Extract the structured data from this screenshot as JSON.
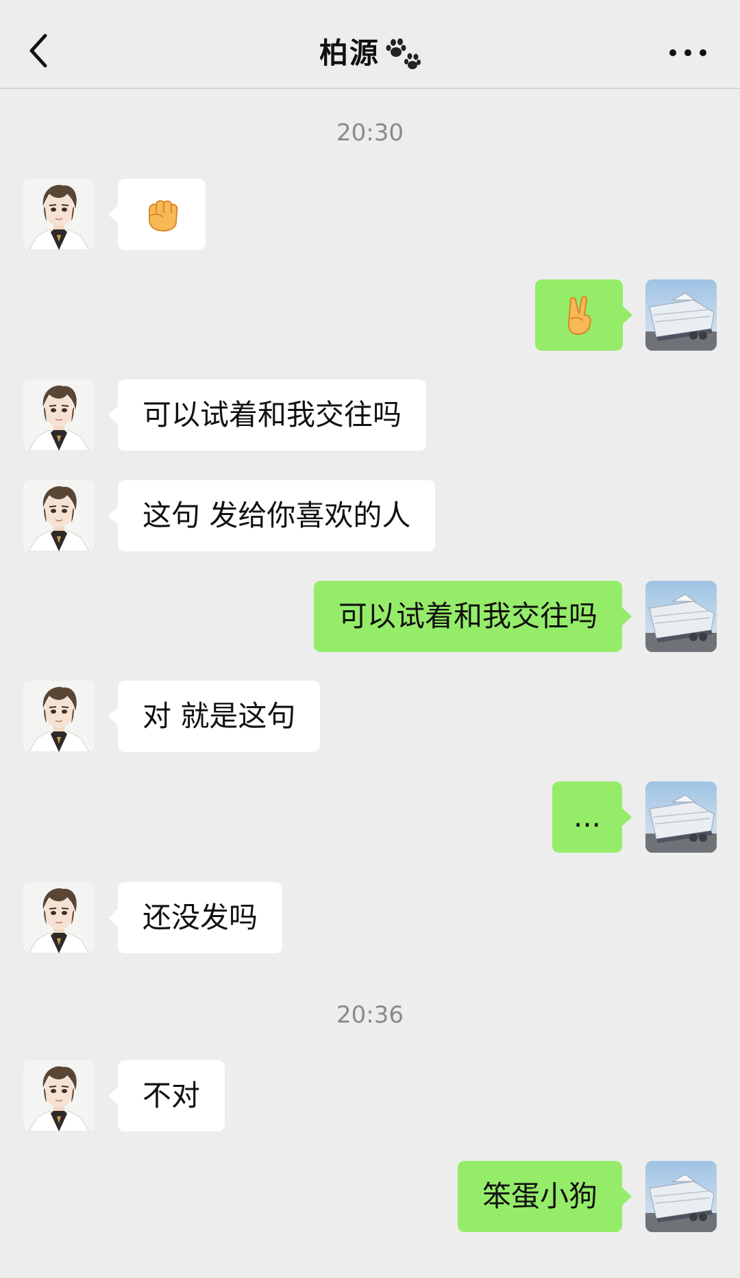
{
  "header": {
    "back_icon": "chevron-left-icon",
    "title": "柏源",
    "title_icon": "paw-prints-icon",
    "more_icon": "ellipsis-icon"
  },
  "chat": {
    "timestamps": [
      "20:30",
      "20:36"
    ],
    "messages": [
      {
        "side": "left",
        "type": "emoji",
        "emoji": "raised-fist"
      },
      {
        "side": "right",
        "type": "emoji",
        "emoji": "victory-hand"
      },
      {
        "side": "left",
        "type": "text",
        "text": "可以试着和我交往吗"
      },
      {
        "side": "left",
        "type": "text",
        "text": "这句 发给你喜欢的人"
      },
      {
        "side": "right",
        "type": "text",
        "text": "可以试着和我交往吗"
      },
      {
        "side": "left",
        "type": "text",
        "text": "对 就是这句"
      },
      {
        "side": "right",
        "type": "text",
        "text": "..."
      },
      {
        "side": "left",
        "type": "text",
        "text": "还没发吗"
      },
      {
        "side": "left",
        "type": "text",
        "text": "不对"
      },
      {
        "side": "right",
        "type": "text",
        "text": "笨蛋小狗"
      }
    ]
  },
  "colors": {
    "background": "#ededed",
    "incoming_bubble": "#ffffff",
    "outgoing_bubble": "#95ec69",
    "timestamp": "#8a8a8a"
  }
}
